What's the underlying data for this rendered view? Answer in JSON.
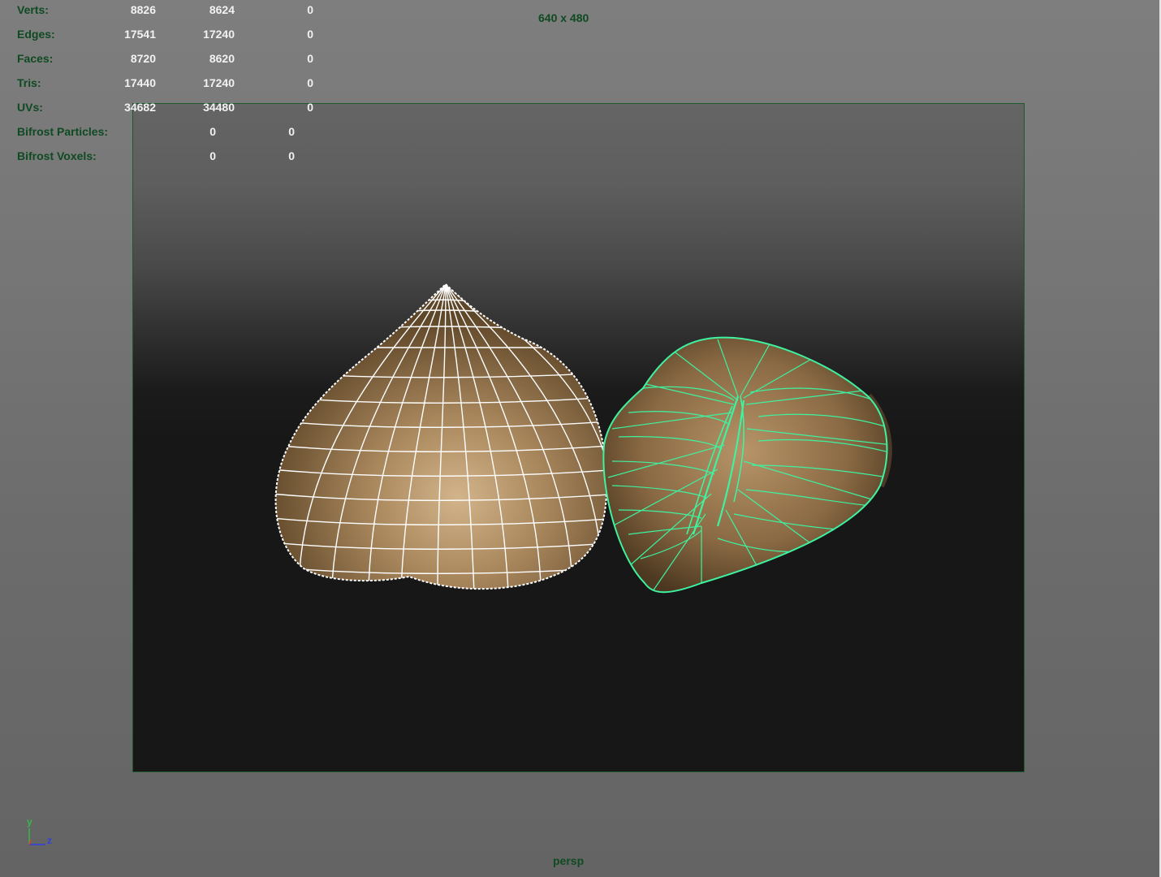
{
  "hud": {
    "rows": [
      {
        "label": "Verts:",
        "values": [
          "8826",
          "8624",
          "0"
        ]
      },
      {
        "label": "Edges:",
        "values": [
          "17541",
          "17240",
          "0"
        ]
      },
      {
        "label": "Faces:",
        "values": [
          "8720",
          "8620",
          "0"
        ]
      },
      {
        "label": "Tris:",
        "values": [
          "17440",
          "17240",
          "0"
        ]
      },
      {
        "label": "UVs:",
        "values": [
          "34682",
          "34480",
          "0"
        ]
      },
      {
        "label": "Bifrost Particles:",
        "values": [
          "0",
          "0"
        ]
      },
      {
        "label": "Bifrost Voxels:",
        "values": [
          "0",
          "0"
        ]
      }
    ]
  },
  "resolution_gate": {
    "label": "640 x 480"
  },
  "camera": {
    "name": "persp"
  },
  "axis": {
    "y": "y",
    "z": "z"
  },
  "objects": [
    {
      "name": "hazelnut-whole",
      "wireframe_color": "#ffffff",
      "state": "selected"
    },
    {
      "name": "hazelnut-half",
      "wireframe_color": "#3ef2a0",
      "state": "active"
    }
  ],
  "colors": {
    "hud_label": "#0f4a22",
    "hud_value": "#f2f2f2",
    "gate_border": "#1c5a2c",
    "nut_shell": "#a88a62",
    "wire_active": "#3ef2a0",
    "wire_selected": "#ffffff"
  }
}
